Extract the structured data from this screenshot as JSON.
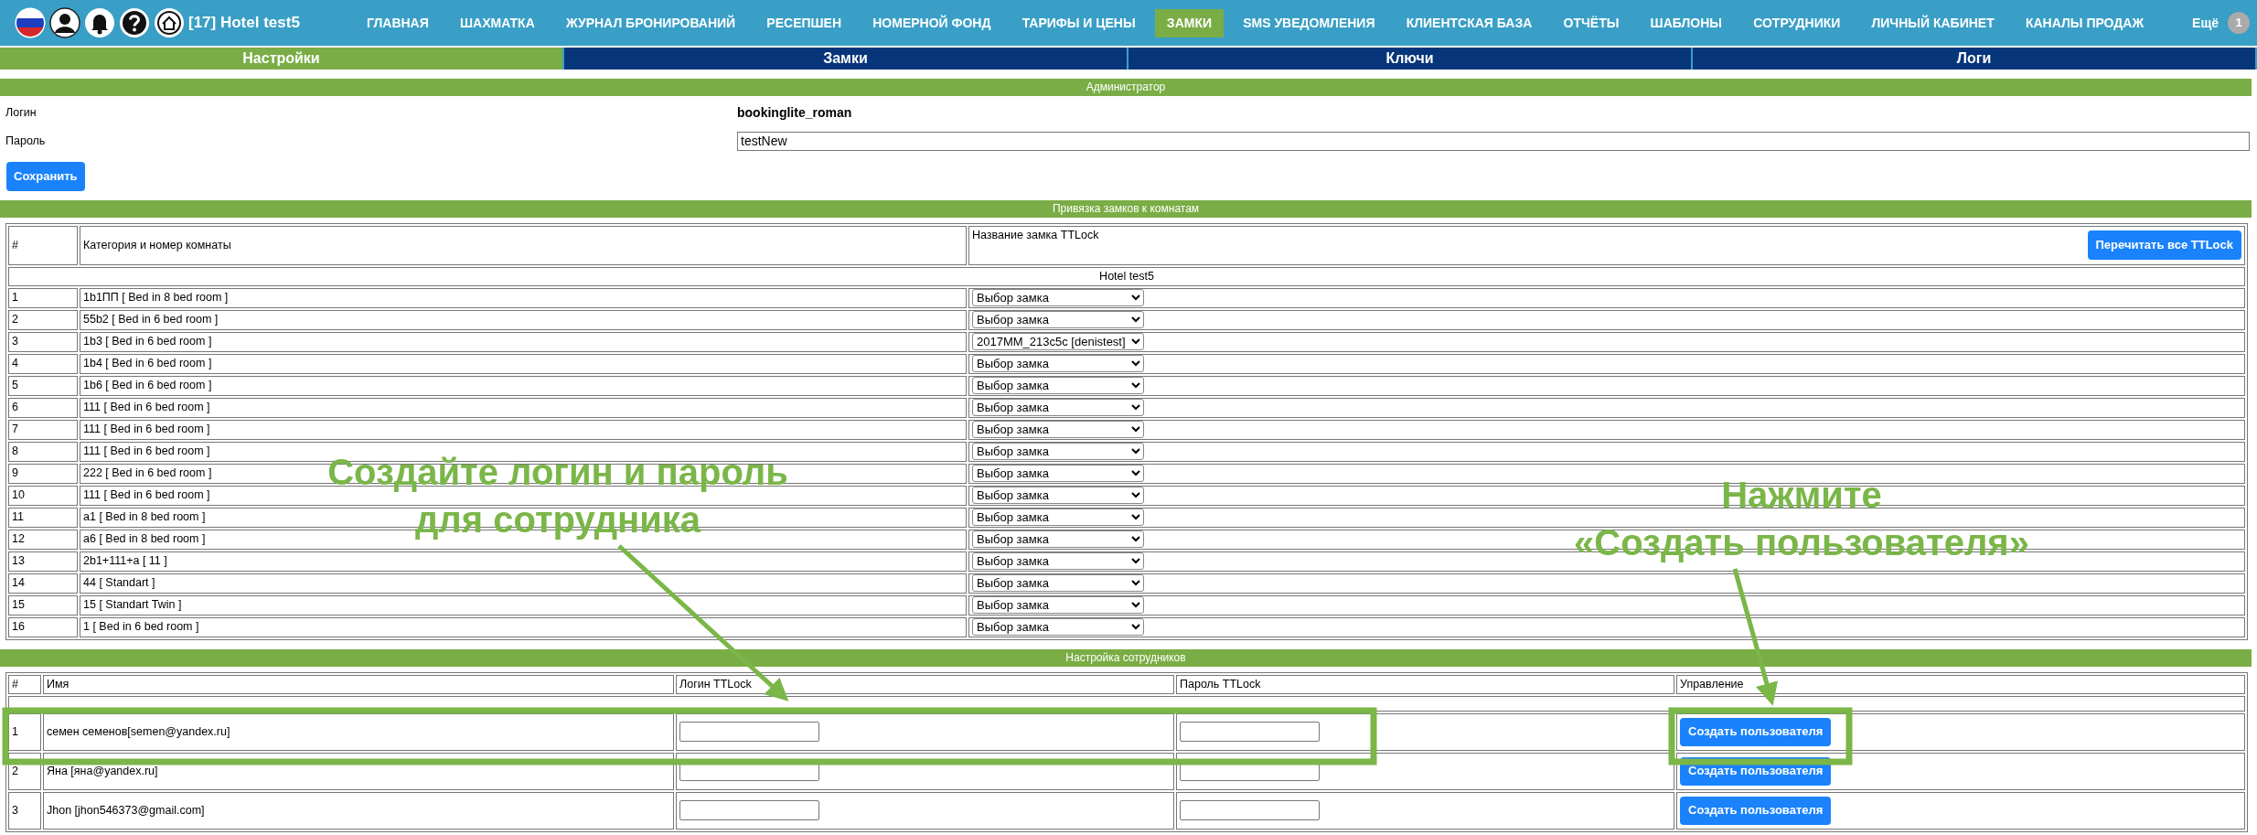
{
  "nav": {
    "hotel": "[17] Hotel test5",
    "more": "Ещё",
    "badge": "1",
    "items": [
      {
        "label": "ГЛАВНАЯ",
        "selected": false
      },
      {
        "label": "ШАХМАТКА",
        "selected": false
      },
      {
        "label": "ЖУРНАЛ БРОНИРОВАНИЙ",
        "selected": false
      },
      {
        "label": "РЕСЕПШЕН",
        "selected": false
      },
      {
        "label": "НОМЕРНОЙ ФОНД",
        "selected": false
      },
      {
        "label": "ТАРИФЫ И ЦЕНЫ",
        "selected": false
      },
      {
        "label": "ЗАМКИ",
        "selected": true
      },
      {
        "label": "SMS УВЕДОМЛЕНИЯ",
        "selected": false
      },
      {
        "label": "КЛИЕНТСКАЯ БАЗА",
        "selected": false
      },
      {
        "label": "ОТЧЁТЫ",
        "selected": false
      },
      {
        "label": "ШАБЛОНЫ",
        "selected": false
      },
      {
        "label": "СОТРУДНИКИ",
        "selected": false
      },
      {
        "label": "ЛИЧНЫЙ КАБИНЕТ",
        "selected": false
      },
      {
        "label": "КАНАЛЫ ПРОДАЖ",
        "selected": false
      }
    ]
  },
  "subtabs": [
    {
      "label": "Настройки",
      "selected": true
    },
    {
      "label": "Замки",
      "selected": false
    },
    {
      "label": "Ключи",
      "selected": false
    },
    {
      "label": "Логи",
      "selected": false
    }
  ],
  "admin": {
    "title": "Администратор",
    "login_label": "Логин",
    "login_value": "bookinglite_roman",
    "password_label": "Пароль",
    "password_value": "testNew",
    "save_button": "Сохранить"
  },
  "locks": {
    "title": "Привязка замков к комнатам",
    "columns": [
      "#",
      "Категория и номер комнаты",
      "Название замка TTLock"
    ],
    "reread_button": "Перечитать все TTLock",
    "group": "Hotel test5",
    "rows": [
      {
        "num": "1",
        "room": "1b1ПП [ Bed in 8 bed room ]",
        "lock": "Выбор замка"
      },
      {
        "num": "2",
        "room": "55b2 [ Bed in 6 bed room ]",
        "lock": "Выбор замка"
      },
      {
        "num": "3",
        "room": "1b3 [ Bed in 6 bed room ]",
        "lock": "2017MM_213c5c [denistest]"
      },
      {
        "num": "4",
        "room": "1b4 [ Bed in 6 bed room ]",
        "lock": "Выбор замка"
      },
      {
        "num": "5",
        "room": "1b6 [ Bed in 6 bed room ]",
        "lock": "Выбор замка"
      },
      {
        "num": "6",
        "room": "111 [ Bed in 6 bed room ]",
        "lock": "Выбор замка"
      },
      {
        "num": "7",
        "room": "111 [ Bed in 6 bed room ]",
        "lock": "Выбор замка"
      },
      {
        "num": "8",
        "room": "111 [ Bed in 6 bed room ]",
        "lock": "Выбор замка"
      },
      {
        "num": "9",
        "room": "222 [ Bed in 6 bed room ]",
        "lock": "Выбор замка"
      },
      {
        "num": "10",
        "room": "111 [ Bed in 6 bed room ]",
        "lock": "Выбор замка"
      },
      {
        "num": "11",
        "room": "a1 [ Bed in 8 bed room ]",
        "lock": "Выбор замка"
      },
      {
        "num": "12",
        "room": "a6 [ Bed in 8 bed room ]",
        "lock": "Выбор замка"
      },
      {
        "num": "13",
        "room": "2b1+111+a [ 11 ]",
        "lock": "Выбор замка"
      },
      {
        "num": "14",
        "room": "44 [ Standart ]",
        "lock": "Выбор замка"
      },
      {
        "num": "15",
        "room": "15 [ Standart Twin ]",
        "lock": "Выбор замка"
      },
      {
        "num": "16",
        "room": "1 [ Bed in 6 bed room ]",
        "lock": "Выбор замка"
      }
    ]
  },
  "staff": {
    "title": "Настройка сотрудников",
    "columns": [
      "#",
      "Имя",
      "Логин TTLock",
      "Пароль TTLock",
      "Управление"
    ],
    "rows": [
      {
        "num": "1",
        "name": "семен семенов[semen@yandex.ru]",
        "action": "Создать пользователя"
      },
      {
        "num": "2",
        "name": "Яна [яна@yandex.ru]",
        "action": "Создать пользователя"
      },
      {
        "num": "3",
        "name": "Jhon [jhon546373@gmail.com]",
        "action": "Создать пользователя"
      }
    ]
  },
  "annotations": [
    {
      "lines": [
        "Создайте логин и пароль",
        "для сотрудника"
      ]
    },
    {
      "lines": [
        "Нажмите",
        "«Создать пользователя»"
      ]
    }
  ]
}
